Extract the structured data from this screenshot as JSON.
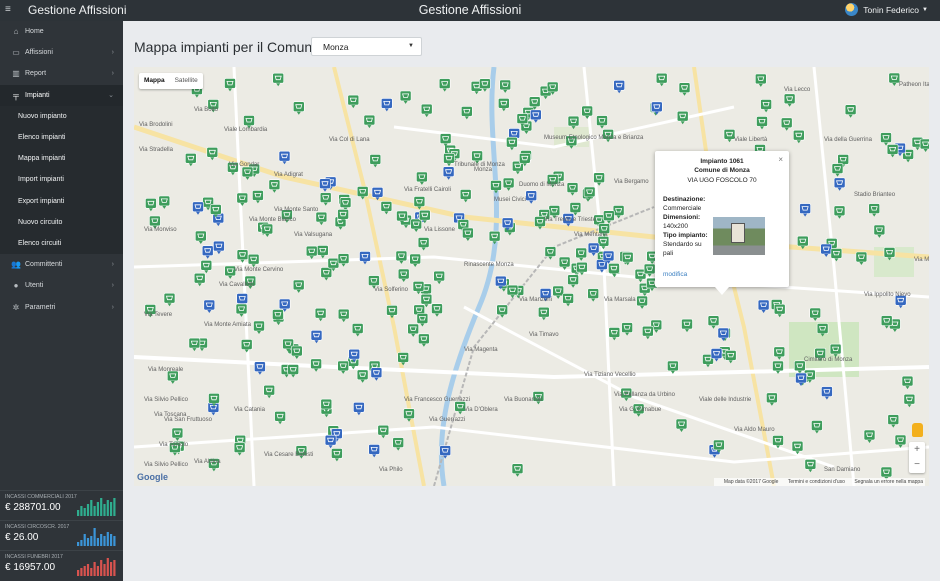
{
  "topbar": {
    "menu_glyph": "≡",
    "brand": "Gestione Affissioni",
    "title": "Gestione Affissioni",
    "user_name": "Tonin Federico"
  },
  "sidebar": {
    "items": [
      {
        "label": "Home",
        "icon": "home-icon",
        "glyph": "⌂"
      },
      {
        "label": "Affissioni",
        "icon": "billboard-icon",
        "glyph": "▭"
      },
      {
        "label": "Report",
        "icon": "bar-chart-icon",
        "glyph": "▥"
      },
      {
        "label": "Impianti",
        "icon": "signpost-icon",
        "glyph": "╤"
      },
      {
        "label": "Committenti",
        "icon": "users-icon",
        "glyph": "👥"
      },
      {
        "label": "Utenti",
        "icon": "user-icon",
        "glyph": "●"
      },
      {
        "label": "Parametri",
        "icon": "gear-icon",
        "glyph": "✲"
      }
    ],
    "submenu": [
      "Nuovo impianto",
      "Elenco impianti",
      "Mappa impianti",
      "Import impianti",
      "Export impianti",
      "Nuovo circuito",
      "Elenco circuiti"
    ]
  },
  "stats": [
    {
      "label": "INCASSI COMMERCIALI 2017",
      "value": "€ 288701.00",
      "color": "#2fae8f",
      "bars": [
        3,
        5,
        4,
        6,
        8,
        5,
        7,
        9,
        6,
        8,
        7,
        9
      ]
    },
    {
      "label": "INCASSI CIRCOSCR. 2017",
      "value": "€ 26.00",
      "color": "#3b95d8",
      "bars": [
        2,
        3,
        6,
        4,
        5,
        9,
        4,
        6,
        5,
        7,
        6,
        5
      ]
    },
    {
      "label": "INCASSI FUNEBRI 2017",
      "value": "€ 16957.00",
      "color": "#d9534f",
      "bars": [
        3,
        4,
        5,
        6,
        4,
        7,
        5,
        8,
        6,
        9,
        7,
        8
      ]
    }
  ],
  "main": {
    "title": "Mappa impianti per il Comune di",
    "city_select": "Monza"
  },
  "map": {
    "type_mappa": "Mappa",
    "type_satellite": "Satellite",
    "labels": [
      "Via Brodolini",
      "Via Boito",
      "Via Col di Lana",
      "Via Gondar",
      "Via Adigrat",
      "Via Monte Santo",
      "Via Monte Bianco",
      "Via Valsugana",
      "Via Monte Cervino",
      "Via Cavallotti",
      "Via Tevere",
      "Via Monte Amiata",
      "Via Monreale",
      "Via Solferino",
      "Via Toscana",
      "Via Silvio Pellico",
      "Rinascente Monza",
      "Monza",
      "Duomo di Monza",
      "Musei Civici",
      "Tribunale di Monza",
      "Museum Etnologico Monza e Brianza",
      "Via Bergamo",
      "Via Mentana",
      "Via Manzoni",
      "Via Timavo",
      "Via Lecco",
      "Via Francesco Guerrazzi",
      "Via Aldo Mauro",
      "Via Catania",
      "Viale Libertà",
      "Via della Guerrina",
      "Stadio Brianteo",
      "Via Ippolito Nievo",
      "Via Magellano",
      "Cimitero di Monza",
      "San Damiano",
      "Via Cesare Battisti",
      "Viale delle Industrie",
      "Via G. Cimabue",
      "Via Tiziano Vecellio",
      "Via Pallanza da Urbino",
      "Via Toniolo",
      "Via Aldina",
      "Via Silvio Pellico",
      "Via Monviso",
      "Via Trento e Trieste",
      "Via San Fruttuoso",
      "Via Buonarroti",
      "Patheon Ita",
      "Via Marsala",
      "Via Guerrazzi",
      "Via Fratelli Cairoli",
      "Via Stradella",
      "Via Philo",
      "Viale Lombardia",
      "Via Lissone",
      "Via Magenta",
      "Via D'Oblera",
      "Via Libertà"
    ],
    "info_window": {
      "title": "Impianto 1061",
      "comune": "Comune di Monza",
      "address": "VIA UGO FOSCOLO 70",
      "destinazione_label": "Destinazione:",
      "destinazione": "Commerciale",
      "dimensioni_label": "Dimensioni:",
      "dimensioni": "140x200",
      "tipo_label": "Tipo impianto:",
      "tipo": "Stendardo su pali",
      "link": "modifica",
      "close_glyph": "×"
    },
    "zoom_in": "+",
    "zoom_out": "−",
    "google": "Google",
    "attribution": [
      "Map data ©2017 Google",
      "Termini e condizioni d'uso",
      "Segnala un errore nella mappa"
    ],
    "colors": {
      "green_marker": "#3e9d5c",
      "blue_marker": "#3568c0",
      "river": "#a8cdea",
      "major_road": "#f7e3a3"
    }
  }
}
